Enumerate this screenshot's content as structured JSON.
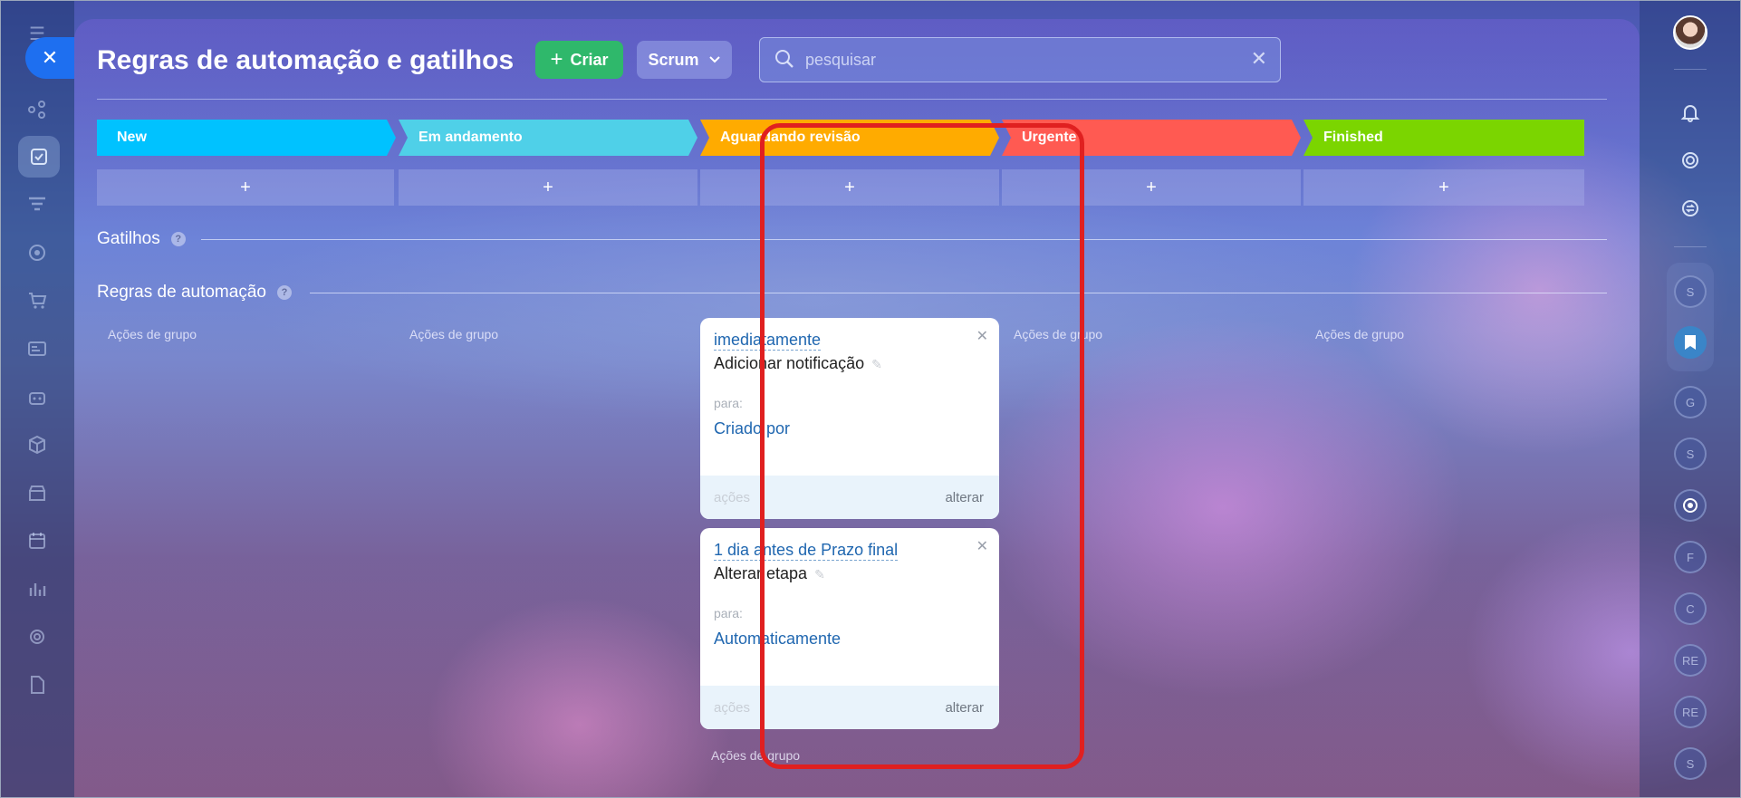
{
  "page": {
    "title": "Regras de automação e gatilhos",
    "create_label": "Criar",
    "scrum_label": "Scrum",
    "search_placeholder": "pesquisar"
  },
  "stages": [
    {
      "name": "New",
      "color": "#00c2ff"
    },
    {
      "name": "Em andamento",
      "color": "#4fd0e8"
    },
    {
      "name": "Aguardando revisão",
      "color": "#ffab00"
    },
    {
      "name": "Urgente",
      "color": "#ff5a52"
    },
    {
      "name": "Finished",
      "color": "#7bd500"
    }
  ],
  "add_symbol": "+",
  "sections": {
    "triggers": "Gatilhos",
    "rules": "Regras de automação",
    "help": "?"
  },
  "group_actions": "Ações de grupo",
  "rules": [
    {
      "trigger": "imediatamente",
      "action": "Adicionar notificação",
      "to_label": "para:",
      "to_value": "Criado por",
      "actions_label": "ações",
      "edit_label": "alterar"
    },
    {
      "trigger": "1 dia antes de Prazo final",
      "action": "Alterar etapa",
      "to_label": "para:",
      "to_value": "Automaticamente",
      "actions_label": "ações",
      "edit_label": "alterar"
    }
  ],
  "right_sidebar": {
    "badges": [
      "S",
      "G",
      "S",
      "F",
      "C",
      "RE",
      "RE",
      "S"
    ]
  },
  "colors": {
    "create_button": "#2fb86b",
    "close_button": "#1e6ff0",
    "highlight": "#e02020",
    "link": "#2067b0"
  }
}
